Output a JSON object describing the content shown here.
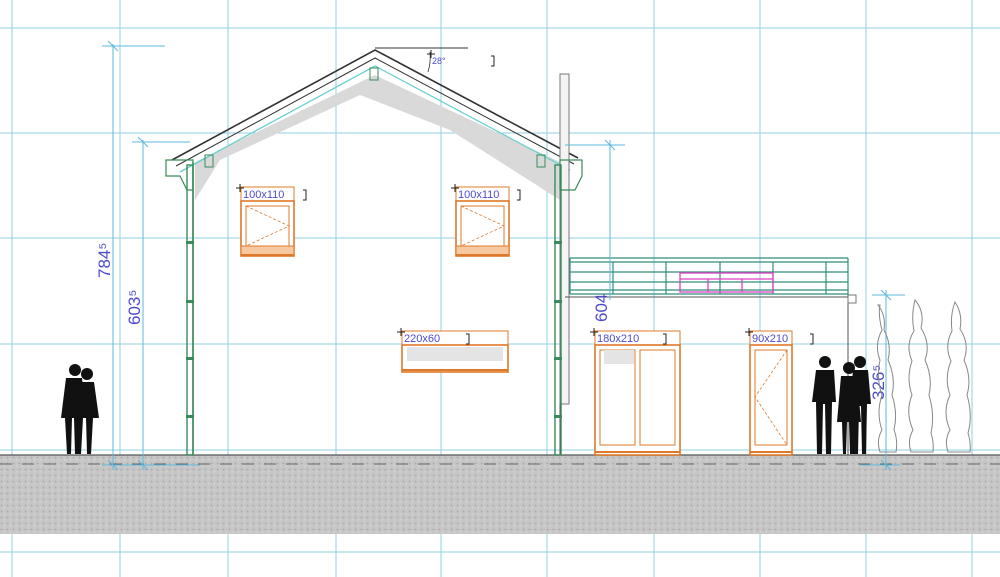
{
  "colors": {
    "grid": "#8fd0e0",
    "dimension": "#4b4bcc",
    "window_frame": "#e0782a",
    "gutter": "#3a8a5a",
    "railing": "#2f8f7a",
    "planter": "#e040c0",
    "roof_line": "#6ad0d0",
    "ground": "#c8c8c8"
  },
  "roof_angle_label": "28°",
  "dimensions": {
    "total_height": "784⁵",
    "eave_height": "603⁵",
    "extension_height": "604",
    "parapet_height": "326⁵"
  },
  "windows": {
    "w1": "100x110",
    "w2": "100x110",
    "w3": "220x60",
    "door1": "180x210",
    "door2": "90x210"
  },
  "icons": [
    "people-silhouette-icon",
    "tree-icon"
  ]
}
